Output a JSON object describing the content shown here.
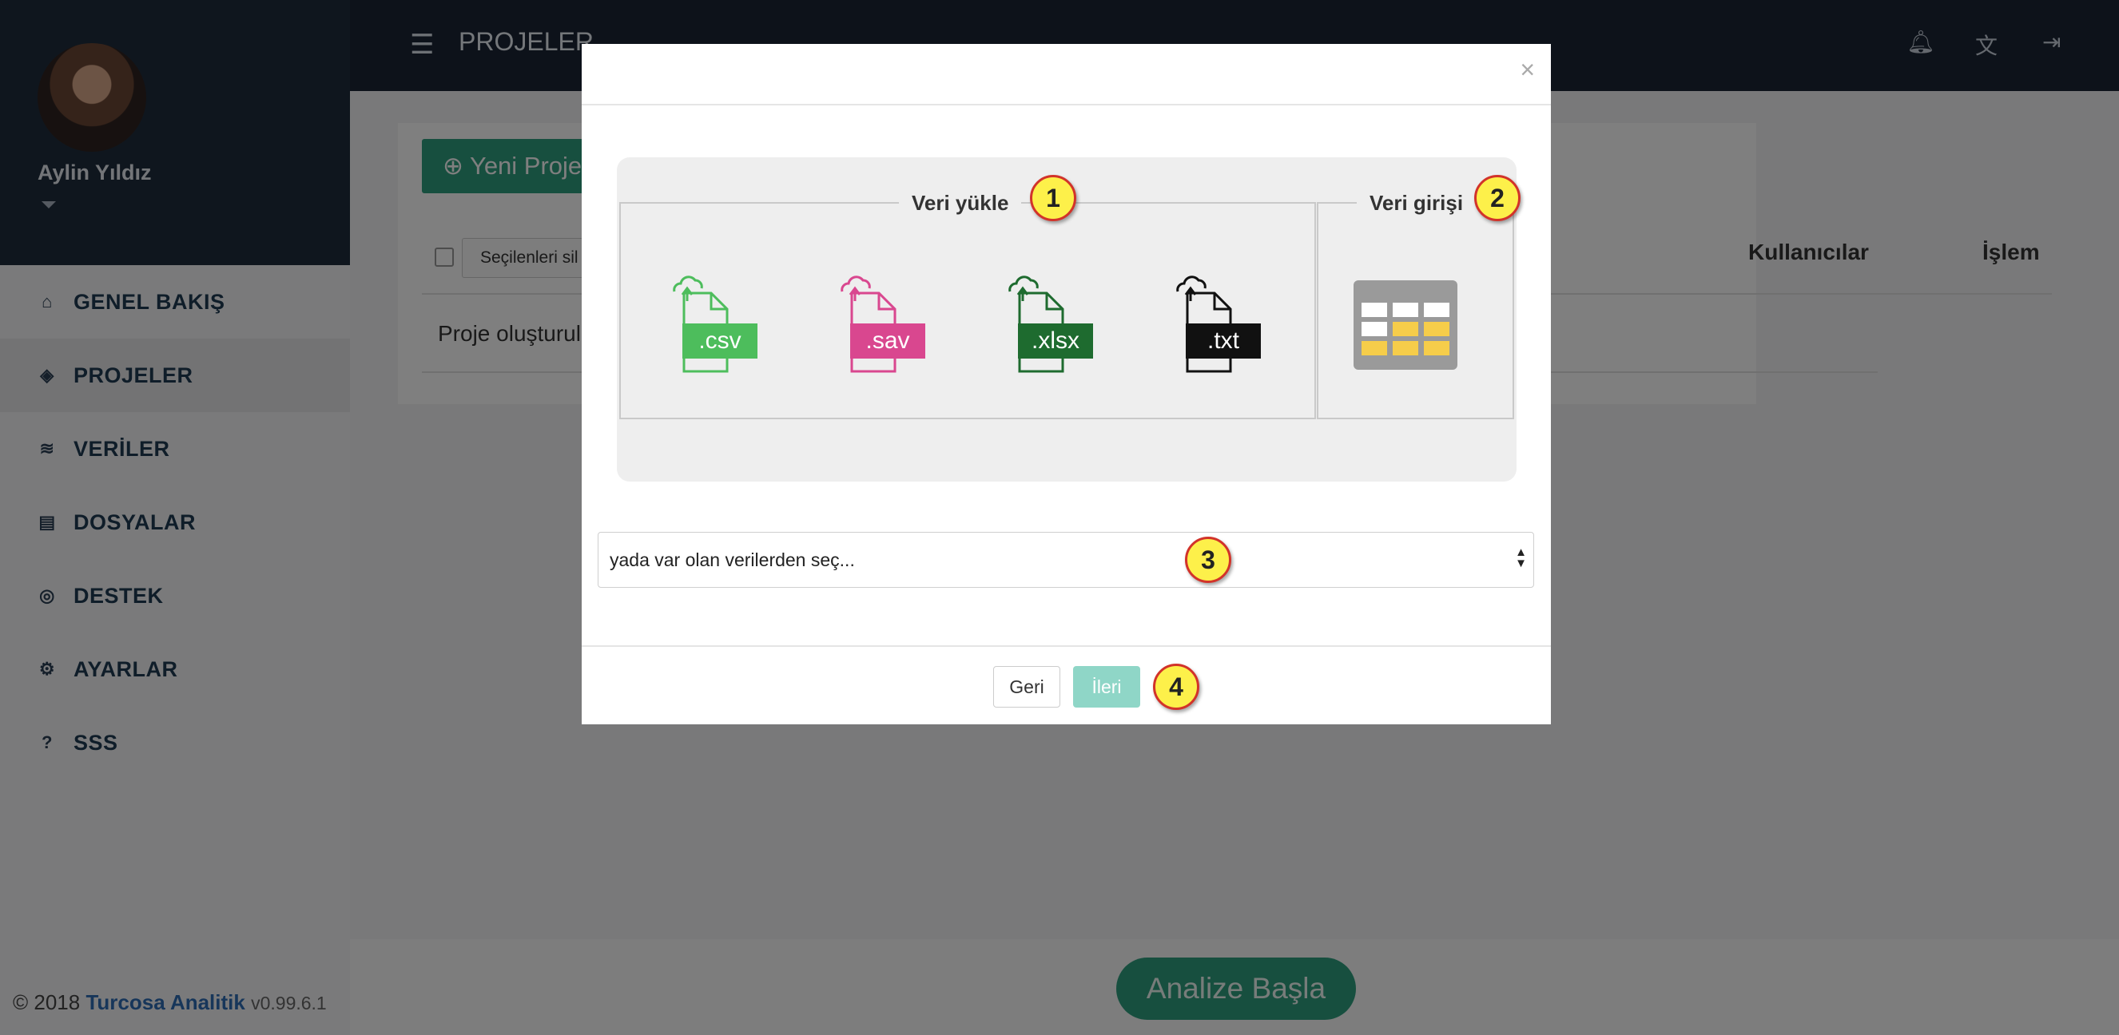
{
  "user": {
    "name": "Aylin Yıldız"
  },
  "sidebar": {
    "items": [
      {
        "label": "GENEL BAKIŞ",
        "icon": "home-icon"
      },
      {
        "label": "PROJELER",
        "icon": "cube-icon",
        "active": true
      },
      {
        "label": "VERİLER",
        "icon": "database-icon"
      },
      {
        "label": "DOSYALAR",
        "icon": "file-icon"
      },
      {
        "label": "DESTEK",
        "icon": "lifebuoy-icon"
      },
      {
        "label": "AYARLAR",
        "icon": "gear-icon"
      },
      {
        "label": "SSS",
        "icon": "question-icon"
      }
    ]
  },
  "footer": {
    "copyright": "© 2018",
    "brand": "Turcosa Analitik",
    "version": "v0.99.6.1"
  },
  "header": {
    "title": "PROJELER"
  },
  "content": {
    "new_project_label": "Yeni Proje",
    "delete_selected_label": "Seçilenleri sil",
    "col_users": "Kullanıcılar",
    "col_action": "İşlem",
    "row_text": "Proje oluşturul"
  },
  "bottom": {
    "start_label": "Analize Başla"
  },
  "modal": {
    "close_label": "×",
    "upload_legend": "Veri yükle",
    "entry_legend": "Veri girişi",
    "files": [
      {
        "ext": ".csv",
        "color": "#4dbd5c"
      },
      {
        "ext": ".sav",
        "color": "#d9478f"
      },
      {
        "ext": ".xlsx",
        "color": "#1e6b2f"
      },
      {
        "ext": ".txt",
        "color": "#111111"
      }
    ],
    "select_placeholder": "yada var olan verilerden seç...",
    "back_label": "Geri",
    "next_label": "İleri",
    "markers": [
      "1",
      "2",
      "3",
      "4"
    ]
  },
  "colors": {
    "primary": "#2f9e7e",
    "topbar": "#1b2535",
    "marker": "#fdf04a"
  }
}
